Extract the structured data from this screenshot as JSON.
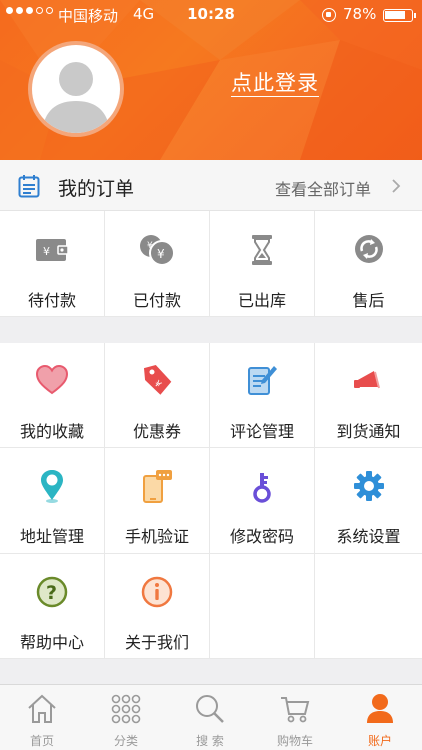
{
  "status_bar": {
    "carrier": "中国移动",
    "network": "4G",
    "time": "10:28",
    "battery": "78%"
  },
  "header": {
    "login_text": "点此登录"
  },
  "orders": {
    "title": "我的订单",
    "view_all": "查看全部订单",
    "items": [
      {
        "label": "待付款",
        "icon": "wallet-icon"
      },
      {
        "label": "已付款",
        "icon": "coins-icon"
      },
      {
        "label": "已出库",
        "icon": "hourglass-icon"
      },
      {
        "label": "售后",
        "icon": "refresh-icon"
      }
    ]
  },
  "services": {
    "items": [
      {
        "label": "我的收藏",
        "icon": "heart-icon",
        "color": "#e85a6e"
      },
      {
        "label": "优惠券",
        "icon": "coupon-tag-icon",
        "color": "#e84d4d"
      },
      {
        "label": "评论管理",
        "icon": "edit-document-icon",
        "color": "#3f8fd6"
      },
      {
        "label": "到货通知",
        "icon": "megaphone-icon",
        "color": "#e84d4d"
      },
      {
        "label": "地址管理",
        "icon": "location-pin-icon",
        "color": "#2bb5c3"
      },
      {
        "label": "手机验证",
        "icon": "phone-message-icon",
        "color": "#f0a040"
      },
      {
        "label": "修改密码",
        "icon": "key-icon",
        "color": "#6a4fd8"
      },
      {
        "label": "系统设置",
        "icon": "gear-icon",
        "color": "#2f8fd8"
      },
      {
        "label": "帮助中心",
        "icon": "question-icon",
        "color": "#6a8a2a"
      },
      {
        "label": "关于我们",
        "icon": "info-icon",
        "color": "#f07840"
      }
    ]
  },
  "tabbar": {
    "active": "账户",
    "tabs": [
      {
        "label": "首页",
        "icon": "home-icon"
      },
      {
        "label": "分类",
        "icon": "grid-dots-icon"
      },
      {
        "label": "搜 索",
        "icon": "search-icon"
      },
      {
        "label": "购物车",
        "icon": "cart-icon"
      },
      {
        "label": "账户",
        "icon": "user-icon"
      }
    ]
  },
  "colors": {
    "brand": "#f26a1b",
    "header_bg": "#f56a1e"
  }
}
